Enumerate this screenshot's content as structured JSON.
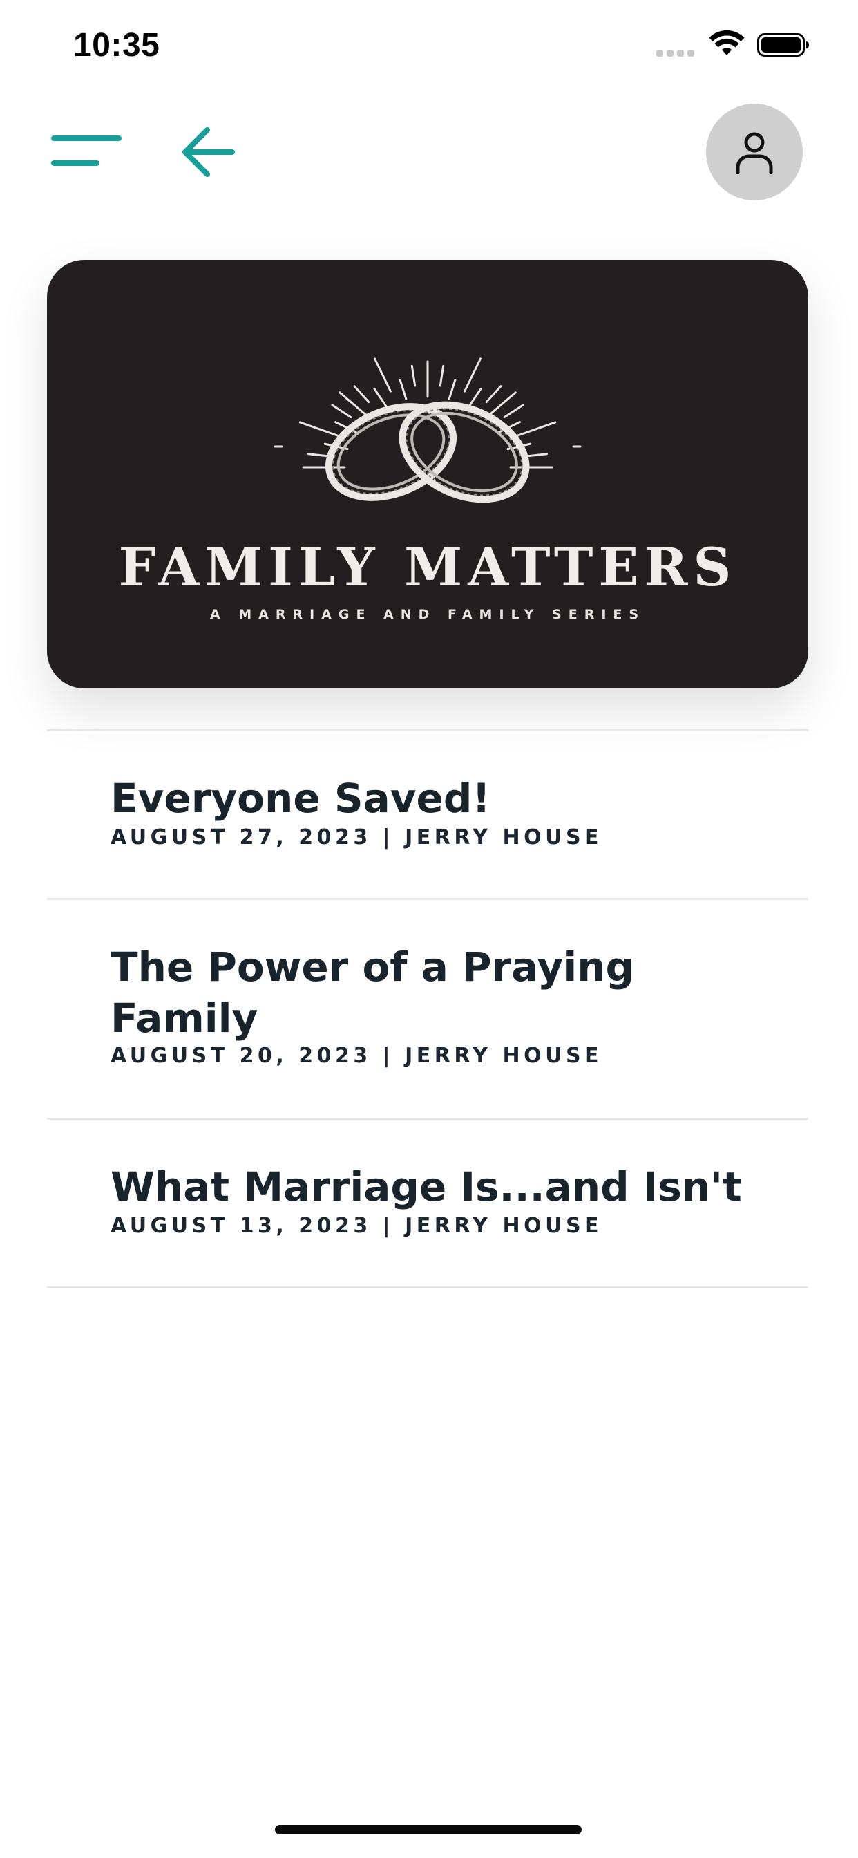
{
  "status_bar": {
    "time": "10:35"
  },
  "nav": {
    "menu_icon": "menu-icon",
    "back_icon": "arrow-left-icon",
    "profile_icon": "user-icon",
    "accent_color": "#17a098"
  },
  "hero": {
    "title": "FAMILY MATTERS",
    "subtitle": "A MARRIAGE AND FAMILY SERIES",
    "art_icon": "wedding-rings-icon",
    "background_color": "#231f20"
  },
  "sermons": [
    {
      "title": "Everyone Saved!",
      "meta": "AUGUST 27, 2023 | JERRY HOUSE"
    },
    {
      "title": "The Power of a Praying Family",
      "meta": "AUGUST 20, 2023 | JERRY HOUSE"
    },
    {
      "title": "What Marriage Is...and Isn't",
      "meta": "AUGUST 13, 2023 | JERRY HOUSE"
    }
  ]
}
